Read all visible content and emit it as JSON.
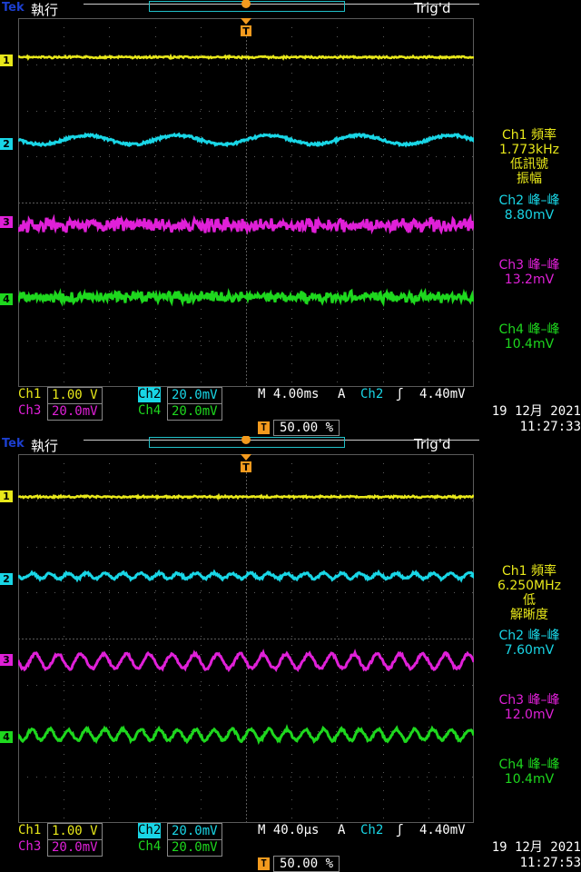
{
  "colors": {
    "ch1": "#e8e81a",
    "ch2": "#19d6e6",
    "ch3": "#e020d8",
    "ch4": "#1ed81e",
    "grid": "#5a5a5a",
    "trigger": "#f39a1e"
  },
  "screens": [
    {
      "brand": "Tek",
      "mode": "執行",
      "trig_status": "Trig'd",
      "meas": [
        {
          "label": "Ch1 頻率",
          "value": "1.773kHz",
          "note": "低訊號",
          "note2": "振幅"
        },
        {
          "label": "Ch2 峰–峰",
          "value": "8.80mV"
        },
        {
          "label": "Ch3 峰–峰",
          "value": "13.2mV"
        },
        {
          "label": "Ch4 峰–峰",
          "value": "10.4mV"
        }
      ],
      "settings": {
        "ch1_label": "Ch1",
        "ch1_scale": "1.00 V",
        "ch2_label": "Ch2",
        "ch2_scale": "20.0mV",
        "ch3_label": "Ch3",
        "ch3_scale": "20.0mV",
        "ch4_label": "Ch4",
        "ch4_scale": "20.0mV",
        "timebase": "M 4.00ms",
        "trig_mode": "A",
        "trig_src": "Ch2",
        "trig_slope": "ʃ",
        "trig_level": "4.40mV",
        "trig_pos": "50.00 %"
      },
      "date": "19 12月 2021",
      "time": "11:27:33",
      "waves": {
        "ch2_cycles": 5,
        "ch3_cycles": 0,
        "ch4_cycles": 0
      }
    },
    {
      "brand": "Tek",
      "mode": "執行",
      "trig_status": "Trig'd",
      "meas": [
        {
          "label": "Ch1 頻率",
          "value": "6.250MHz",
          "note": "低",
          "note2": "解晰度"
        },
        {
          "label": "Ch2 峰–峰",
          "value": "7.60mV"
        },
        {
          "label": "Ch3 峰–峰",
          "value": "12.0mV"
        },
        {
          "label": "Ch4 峰–峰",
          "value": "10.4mV"
        }
      ],
      "settings": {
        "ch1_label": "Ch1",
        "ch1_scale": "1.00 V",
        "ch2_label": "Ch2",
        "ch2_scale": "20.0mV",
        "ch3_label": "Ch3",
        "ch3_scale": "20.0mV",
        "ch4_label": "Ch4",
        "ch4_scale": "20.0mV",
        "timebase": "M 40.0µs",
        "trig_mode": "A",
        "trig_src": "Ch2",
        "trig_slope": "ʃ",
        "trig_level": "4.40mV",
        "trig_pos": "50.00 %"
      },
      "date": "19 12月 2021",
      "time": "11:27:53",
      "waves": {
        "ch2_cycles": 25,
        "ch3_cycles": 20,
        "ch4_cycles": 25
      }
    }
  ]
}
